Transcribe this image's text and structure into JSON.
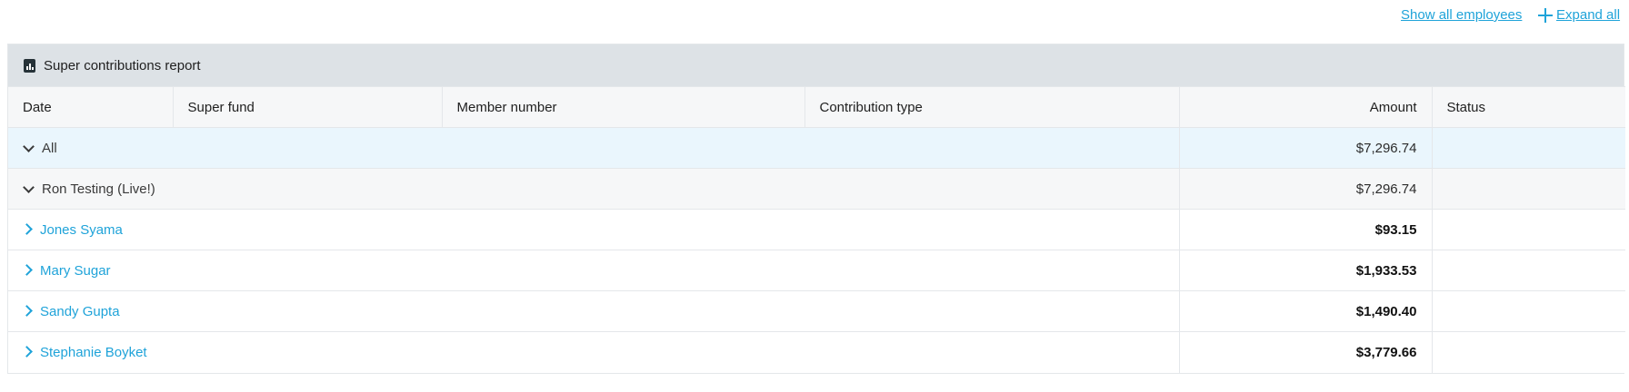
{
  "top_links": {
    "show_all_employees": "Show all employees",
    "expand_all": "Expand all"
  },
  "report": {
    "title": "Super contributions report",
    "columns": {
      "date": "Date",
      "super_fund": "Super fund",
      "member_number": "Member number",
      "contribution_type": "Contribution type",
      "amount": "Amount",
      "status": "Status"
    },
    "all_row": {
      "label": "All",
      "amount": "$7,296.74"
    },
    "group_row": {
      "label": "Ron Testing (Live!)",
      "amount": "$7,296.74"
    },
    "employees": [
      {
        "name": "Jones Syama",
        "amount": "$93.15"
      },
      {
        "name": "Mary Sugar",
        "amount": "$1,933.53"
      },
      {
        "name": "Sandy Gupta",
        "amount": "$1,490.40"
      },
      {
        "name": "Stephanie Boyket",
        "amount": "$3,779.66"
      }
    ]
  },
  "colors": {
    "link": "#1fa3d9",
    "header_bg": "#dde2e6",
    "all_row_bg": "#eaf6fd",
    "group_row_bg": "#f6f7f8"
  }
}
